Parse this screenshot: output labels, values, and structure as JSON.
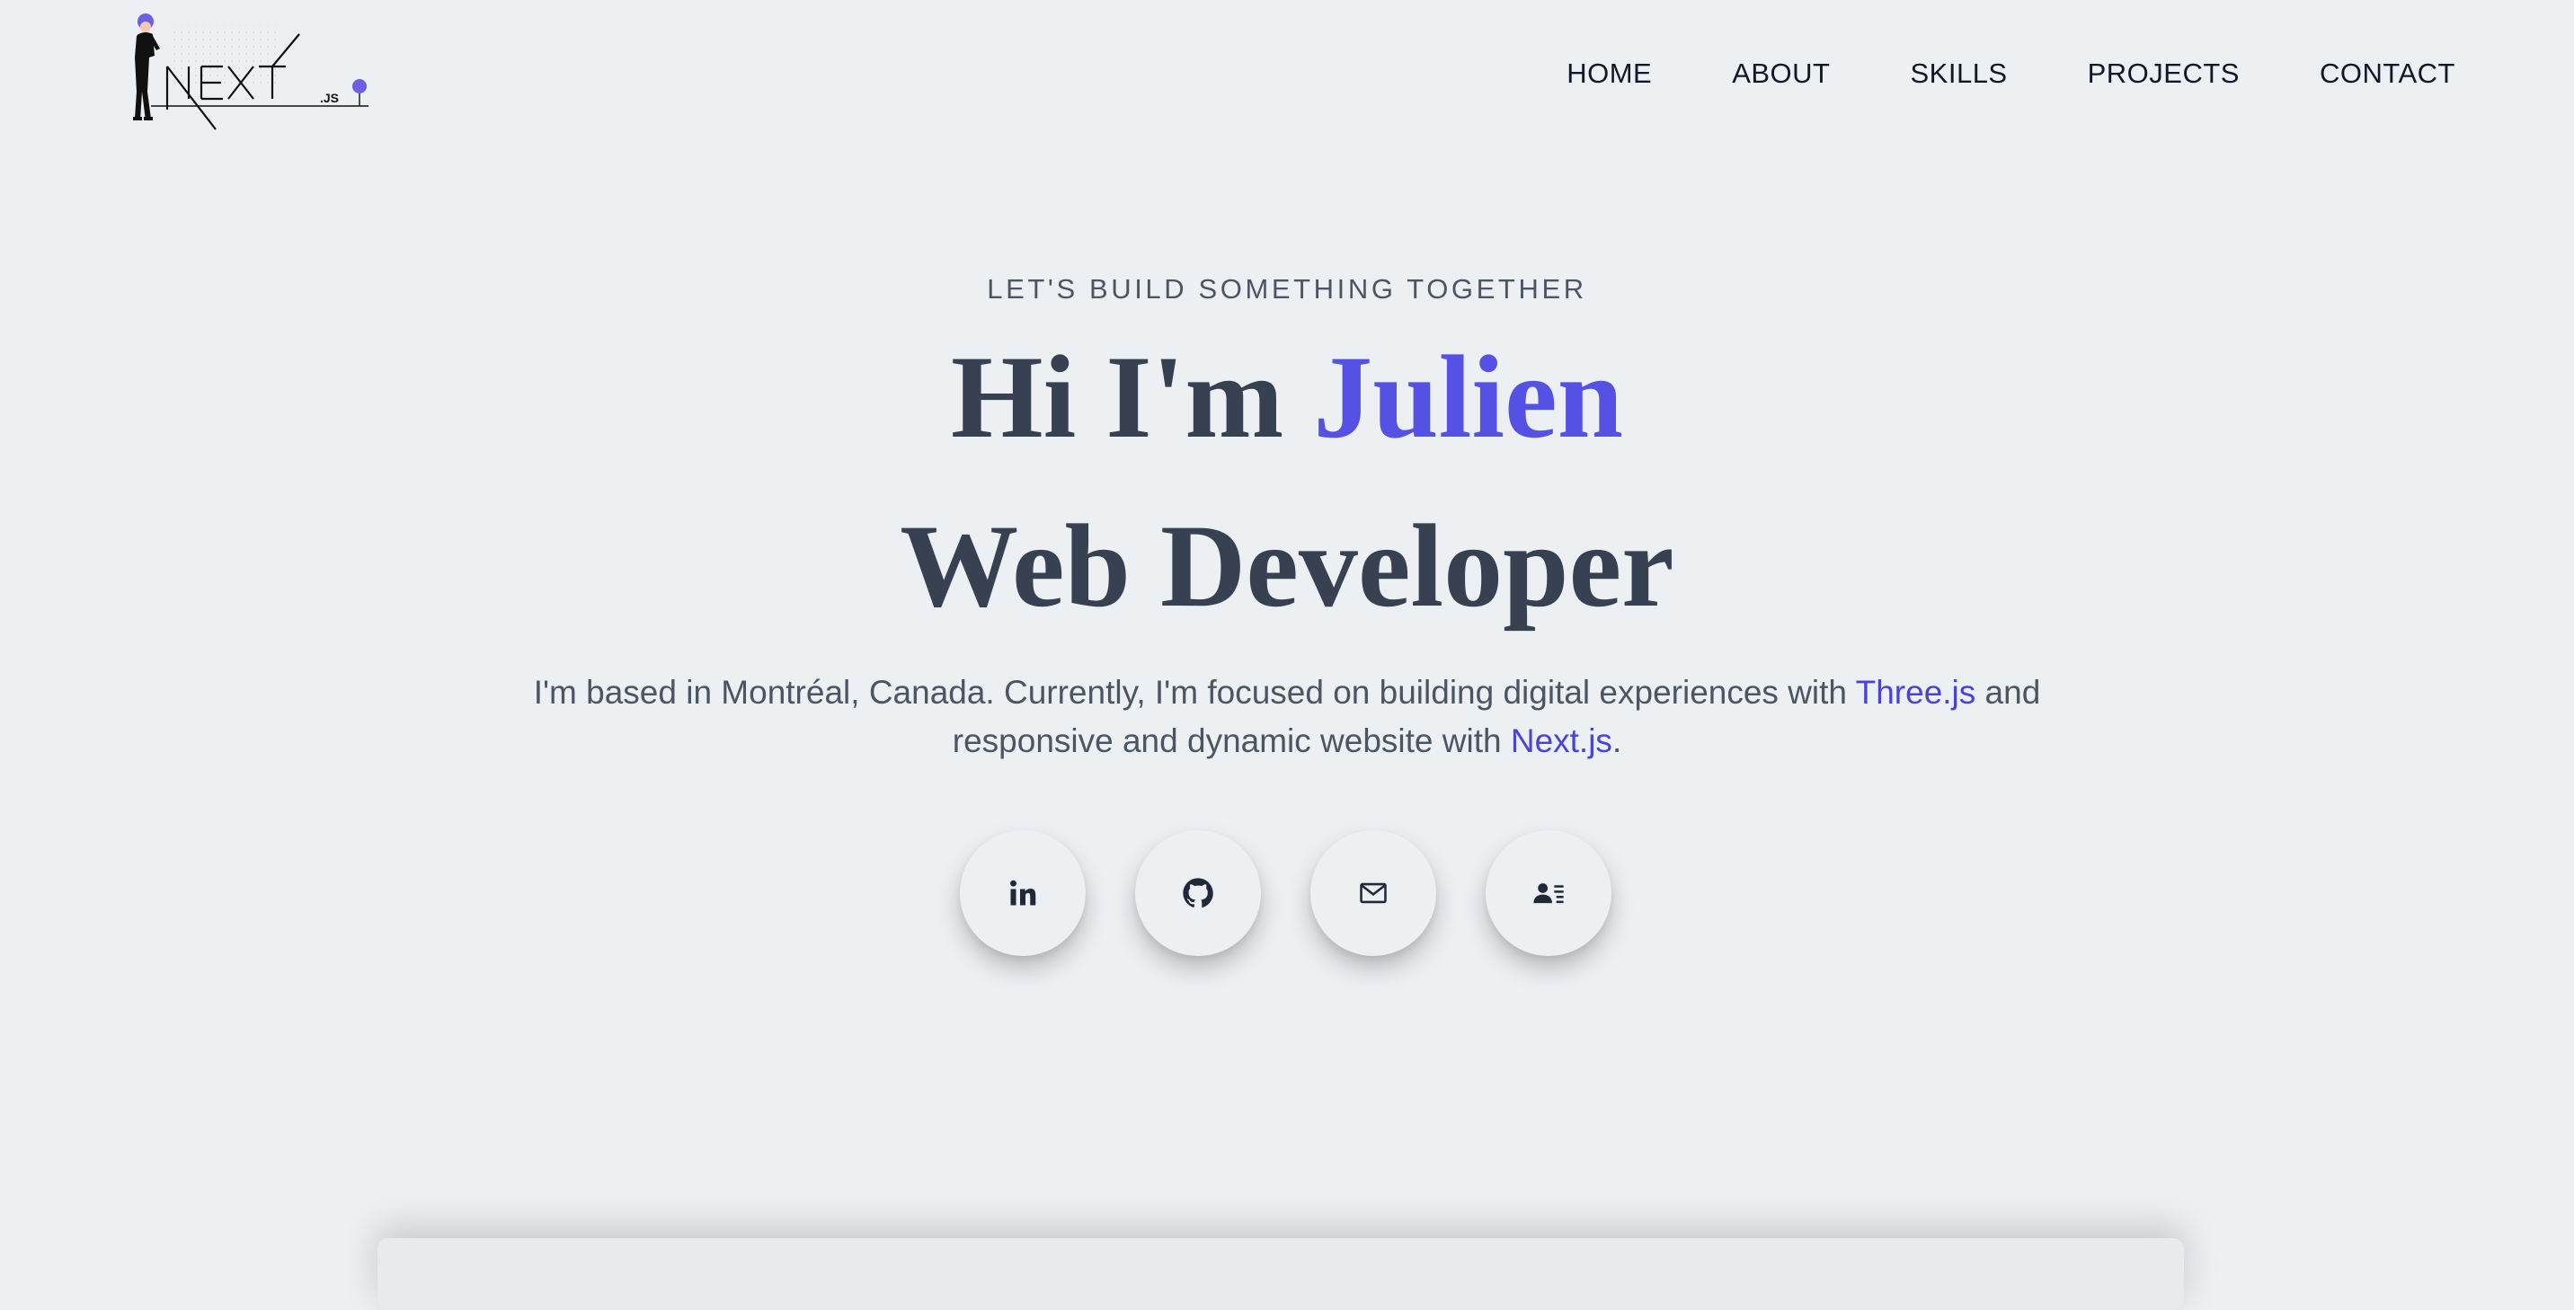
{
  "nav": {
    "logo": {
      "wordmark": "NEXT",
      "suffix": ".JS",
      "accent_color": "#6d5ee8"
    },
    "items": [
      {
        "label": "HOME"
      },
      {
        "label": "ABOUT"
      },
      {
        "label": "SKILLS"
      },
      {
        "label": "PROJECTS"
      },
      {
        "label": "CONTACT"
      }
    ]
  },
  "hero": {
    "eyebrow": "LET'S BUILD SOMETHING TOGETHER",
    "greeting": "Hi I'm ",
    "name": "Julien",
    "role": "Web Developer",
    "intro": {
      "part1": "I'm based in Montréal, Canada. Currently, I'm focused on building digital experiences with ",
      "link1": "Three.js",
      "part2": " and responsive and dynamic website with ",
      "link2": "Next.js",
      "part3": "."
    }
  },
  "socials": [
    {
      "name": "linkedin",
      "icon": "linkedin-icon"
    },
    {
      "name": "github",
      "icon": "github-icon"
    },
    {
      "name": "email",
      "icon": "mail-icon"
    },
    {
      "name": "resume",
      "icon": "contact-card-icon"
    }
  ],
  "colors": {
    "background": "#ecf0f3",
    "accent": "#5651e5",
    "heading": "#374151",
    "body_text": "#4b5563"
  }
}
